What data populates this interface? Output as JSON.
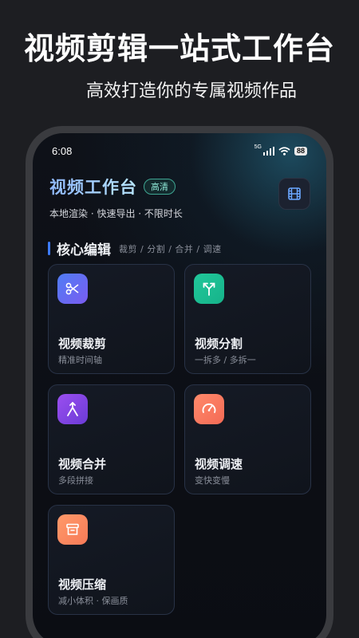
{
  "promo": {
    "title": "视频剪辑一站式工作台",
    "subtitle": "高效打造你的专属视频作品"
  },
  "status_bar": {
    "time": "6:08",
    "network": "5G",
    "battery": "88"
  },
  "header": {
    "title": "视频工作台",
    "badge": "高清",
    "subtitle": "本地渲染 · 快速导出 · 不限时长",
    "film_icon": "film-icon"
  },
  "section": {
    "title": "核心编辑",
    "tags": "裁剪 / 分割 / 合并 / 调速"
  },
  "cards": [
    {
      "title": "视频裁剪",
      "desc": "精准时间轴",
      "icon": "scissors-icon",
      "color_from": "#4f7df5",
      "color_to": "#7a5cf0"
    },
    {
      "title": "视频分割",
      "desc": "一拆多 / 多拆一",
      "icon": "split-arrow-icon",
      "color_from": "#21c79a",
      "color_to": "#16b38a"
    },
    {
      "title": "视频合并",
      "desc": "多段拼接",
      "icon": "merge-arrow-icon",
      "color_from": "#9b4ff0",
      "color_to": "#6b3bd6"
    },
    {
      "title": "视频调速",
      "desc": "变快变慢",
      "icon": "speedometer-icon",
      "color_from": "#ff8a6b",
      "color_to": "#f46a55"
    },
    {
      "title": "视频压缩",
      "desc": "减小体积 · 保画质",
      "icon": "archive-box-icon",
      "color_from": "#ff9a6a",
      "color_to": "#f77a57"
    }
  ]
}
